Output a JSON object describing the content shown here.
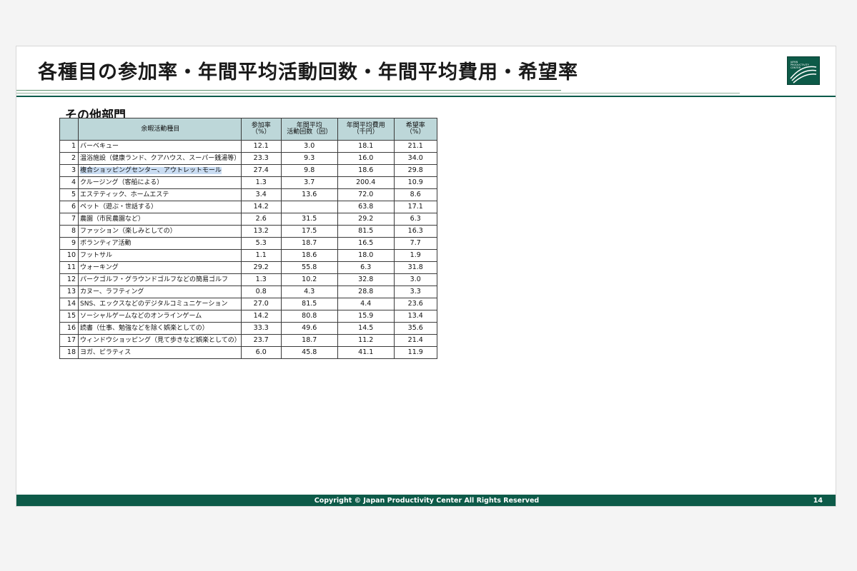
{
  "slide": {
    "title": "各種目の参加率・年間平均活動回数・年間平均費用・希望率",
    "section_title": "その他部門",
    "logo_text": "JAPAN PRODUCTIVITY CENTER",
    "footer": {
      "copyright": "Copyright © Japan Productivity Center All Rights Reserved",
      "page_number": "14"
    }
  },
  "table": {
    "headers": {
      "name": "余暇活動種目",
      "participation_line1": "参加率",
      "participation_line2": "（%）",
      "frequency_line1": "年間平均",
      "frequency_line2": "活動回数（回）",
      "cost_line1": "年間平均費用",
      "cost_line2": "（千円）",
      "hope_line1": "希望率",
      "hope_line2": "（%）"
    },
    "rows": [
      {
        "no": "1",
        "name": "バーベキュー",
        "participation": "12.1",
        "frequency": "3.0",
        "cost": "18.1",
        "hope": "21.1"
      },
      {
        "no": "2",
        "name": "温浴施設（健康ランド、クアハウス、スーパー銭湯等）",
        "participation": "23.3",
        "frequency": "9.3",
        "cost": "16.0",
        "hope": "34.0"
      },
      {
        "no": "3",
        "name": "複合ショッピングセンター、アウトレットモール",
        "participation": "27.4",
        "frequency": "9.8",
        "cost": "18.6",
        "hope": "29.8"
      },
      {
        "no": "4",
        "name": "クルージング（客船による）",
        "participation": "1.3",
        "frequency": "3.7",
        "cost": "200.4",
        "hope": "10.9"
      },
      {
        "no": "5",
        "name": "エステティック、ホームエステ",
        "participation": "3.4",
        "frequency": "13.6",
        "cost": "72.0",
        "hope": "8.6"
      },
      {
        "no": "6",
        "name": "ペット（遊ぶ・世話する）",
        "participation": "14.2",
        "frequency": "",
        "cost": "63.8",
        "hope": "17.1"
      },
      {
        "no": "7",
        "name": "農園（市民農園など）",
        "participation": "2.6",
        "frequency": "31.5",
        "cost": "29.2",
        "hope": "6.3"
      },
      {
        "no": "8",
        "name": "ファッション（楽しみとしての）",
        "participation": "13.2",
        "frequency": "17.5",
        "cost": "81.5",
        "hope": "16.3"
      },
      {
        "no": "9",
        "name": "ボランティア活動",
        "participation": "5.3",
        "frequency": "18.7",
        "cost": "16.5",
        "hope": "7.7"
      },
      {
        "no": "10",
        "name": "フットサル",
        "participation": "1.1",
        "frequency": "18.6",
        "cost": "18.0",
        "hope": "1.9"
      },
      {
        "no": "11",
        "name": "ウォーキング",
        "participation": "29.2",
        "frequency": "55.8",
        "cost": "6.3",
        "hope": "31.8"
      },
      {
        "no": "12",
        "name": "パークゴルフ・グラウンドゴルフなどの簡易ゴルフ",
        "participation": "1.3",
        "frequency": "10.2",
        "cost": "32.8",
        "hope": "3.0"
      },
      {
        "no": "13",
        "name": "カヌー、ラフティング",
        "participation": "0.8",
        "frequency": "4.3",
        "cost": "28.8",
        "hope": "3.3"
      },
      {
        "no": "14",
        "name": "SNS、エックスなどのデジタルコミュニケーション",
        "participation": "27.0",
        "frequency": "81.5",
        "cost": "4.4",
        "hope": "23.6"
      },
      {
        "no": "15",
        "name": "ソーシャルゲームなどのオンラインゲーム",
        "participation": "14.2",
        "frequency": "80.8",
        "cost": "15.9",
        "hope": "13.4"
      },
      {
        "no": "16",
        "name": "読書（仕事、勉強などを除く娯楽としての）",
        "participation": "33.3",
        "frequency": "49.6",
        "cost": "14.5",
        "hope": "35.6"
      },
      {
        "no": "17",
        "name": "ウィンドウショッピング（見て歩きなど娯楽としての）",
        "participation": "23.7",
        "frequency": "18.7",
        "cost": "11.2",
        "hope": "21.4"
      },
      {
        "no": "18",
        "name": "ヨガ、ピラティス",
        "participation": "6.0",
        "frequency": "45.8",
        "cost": "41.1",
        "hope": "11.9"
      }
    ],
    "highlighted_row": "3"
  },
  "colors": {
    "brand_green": "#0d5a48",
    "header_fill": "#bdd7d9",
    "highlight": "#c9dcf2"
  }
}
